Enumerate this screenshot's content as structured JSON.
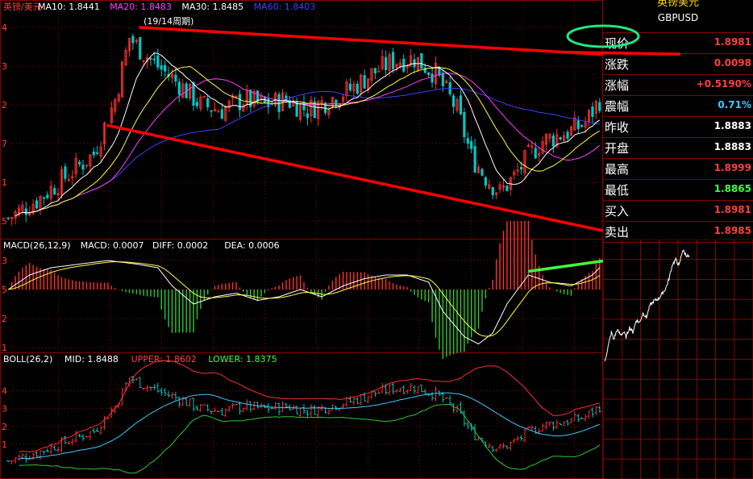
{
  "side": {
    "name": "英镑美元",
    "code": "GBPUSD",
    "rows": [
      {
        "label": "现价",
        "value": "1.8981",
        "color": "#ff4040"
      },
      {
        "label": "涨跌",
        "value": "0.0098",
        "color": "#ff4040"
      },
      {
        "label": "涨幅",
        "value": "+0.5190%",
        "color": "#ff4040"
      },
      {
        "label": "震幅",
        "value": "0.71%",
        "color": "#40c8ff"
      },
      {
        "label": "昨收",
        "value": "1.8883",
        "color": "#ffffff"
      },
      {
        "label": "开盘",
        "value": "1.8883",
        "color": "#ffffff"
      },
      {
        "label": "最高",
        "value": "1.8999",
        "color": "#ff4040"
      },
      {
        "label": "最低",
        "value": "1.8865",
        "color": "#40ff40"
      },
      {
        "label": "买入",
        "value": "1.8981",
        "color": "#ff4040"
      },
      {
        "label": "卖出",
        "value": "1.8985",
        "color": "#ff4040"
      }
    ]
  },
  "colors": {
    "bg": "#000000",
    "grid": "#8b0000",
    "up": "#ff3030",
    "down": "#00c8c8",
    "ma10": "#ffffff",
    "ma20": "#ffff40",
    "ma30": "#ff40ff",
    "ma60": "#4040ff",
    "trend": "#ff0000",
    "macd_up": "#ff3030",
    "macd_down": "#30c830",
    "diff": "#ffffff",
    "dea": "#ffff40",
    "boll_mid": "#40c8ff",
    "boll_upper": "#ff3030",
    "boll_lower": "#30c830",
    "circle": "#20e880",
    "green_trend": "#40ff40"
  },
  "chart_data": [
    {
      "type": "candlestick",
      "legend": [
        {
          "text": "英镑/美元",
          "color": "#ff4040"
        },
        {
          "text": "MA10: 1.8441",
          "color": "#ffffff"
        },
        {
          "text": "MA20: 1.8483",
          "color": "#ff40ff"
        },
        {
          "text": "MA30: 1.8485",
          "color": "#ffffff"
        },
        {
          "text": "MA60: 1.8403",
          "color": "#4040ff"
        }
      ],
      "annotation": "(19/14周期)",
      "ylim": [
        1.82,
        1.905
      ],
      "y_ticks": [
        {
          "v": 1.9,
          "t": "4"
        },
        {
          "v": 1.885,
          "t": "3"
        },
        {
          "v": 1.87,
          "t": "2"
        },
        {
          "v": 1.855,
          "t": "7"
        },
        {
          "v": 1.84,
          "t": "1"
        },
        {
          "v": 1.825,
          "t": "5"
        }
      ],
      "close_path": [
        [
          0,
          1.826
        ],
        [
          8,
          1.833
        ],
        [
          16,
          1.842
        ],
        [
          24,
          1.851
        ],
        [
          30,
          1.872
        ],
        [
          34,
          1.896
        ],
        [
          38,
          1.89
        ],
        [
          42,
          1.885
        ],
        [
          48,
          1.878
        ],
        [
          54,
          1.87
        ],
        [
          60,
          1.868
        ],
        [
          66,
          1.872
        ],
        [
          72,
          1.87
        ],
        [
          78,
          1.872
        ],
        [
          84,
          1.868
        ],
        [
          90,
          1.872
        ],
        [
          96,
          1.876
        ],
        [
          102,
          1.882
        ],
        [
          108,
          1.887
        ],
        [
          114,
          1.888
        ],
        [
          120,
          1.882
        ],
        [
          126,
          1.868
        ],
        [
          130,
          1.85
        ],
        [
          134,
          1.842
        ],
        [
          138,
          1.836
        ],
        [
          142,
          1.842
        ],
        [
          146,
          1.85
        ],
        [
          150,
          1.856
        ],
        [
          154,
          1.858
        ],
        [
          158,
          1.86
        ],
        [
          162,
          1.863
        ],
        [
          166,
          1.872
        ]
      ],
      "trend_lines": [
        {
          "from": [
            37,
            1.9
          ],
          "to": [
            186,
            1.888
          ]
        },
        {
          "from": [
            28,
            1.862
          ],
          "to": [
            178,
            1.818
          ]
        }
      ],
      "n": 167
    },
    {
      "type": "macd",
      "legend": [
        {
          "text": "MACD(26,12,9)",
          "color": "#ffffff"
        },
        {
          "text": "MACD: 0.0007",
          "color": "#ffffff"
        },
        {
          "text": "DIFF: 0.0002",
          "color": "#ffffff"
        },
        {
          "text": "DEA: 0.0006",
          "color": "#ffffff"
        }
      ],
      "ylim": [
        -0.016,
        0.01
      ],
      "y_ticks": [
        {
          "v": 0.008,
          "t": "3"
        },
        {
          "v": 0.0,
          "t": "5"
        },
        {
          "v": -0.008,
          "t": "2"
        },
        {
          "v": -0.016,
          "t": "1"
        }
      ],
      "diff_path": [
        [
          0,
          0.0
        ],
        [
          6,
          0.004
        ],
        [
          12,
          0.006
        ],
        [
          20,
          0.007
        ],
        [
          28,
          0.008
        ],
        [
          36,
          0.007
        ],
        [
          42,
          0.006
        ],
        [
          46,
          0.001
        ],
        [
          52,
          -0.004
        ],
        [
          58,
          -0.002
        ],
        [
          64,
          -0.001
        ],
        [
          70,
          -0.003
        ],
        [
          76,
          -0.002
        ],
        [
          82,
          0.0
        ],
        [
          88,
          -0.002
        ],
        [
          94,
          0.001
        ],
        [
          100,
          0.003
        ],
        [
          106,
          0.004
        ],
        [
          112,
          0.004
        ],
        [
          118,
          0.002
        ],
        [
          122,
          -0.006
        ],
        [
          128,
          -0.013
        ],
        [
          132,
          -0.015
        ],
        [
          136,
          -0.012
        ],
        [
          140,
          -0.004
        ],
        [
          146,
          0.004
        ],
        [
          152,
          0.002
        ],
        [
          158,
          0.001
        ],
        [
          164,
          0.004
        ],
        [
          166,
          0.006
        ]
      ],
      "green_line": {
        "from": [
          146,
          0.005
        ],
        "to": [
          168,
          0.008
        ]
      }
    },
    {
      "type": "boll",
      "legend": [
        {
          "text": "BOLL(26,2)",
          "color": "#ffffff"
        },
        {
          "text": "MID: 1.8488",
          "color": "#ffffff"
        },
        {
          "text": "UPPER: 1.8602",
          "color": "#ff4040"
        },
        {
          "text": "LOWER: 1.8375",
          "color": "#40ff40"
        }
      ],
      "ylim": [
        1.815,
        1.905
      ],
      "y_ticks": [
        {
          "v": 1.885,
          "t": "4"
        },
        {
          "v": 1.87,
          "t": "3"
        },
        {
          "v": 1.855,
          "t": "2"
        },
        {
          "v": 1.84,
          "t": "1"
        }
      ]
    },
    {
      "type": "line",
      "note": "intraday tick chart",
      "y_path": [
        [
          0,
          0.05
        ],
        [
          3,
          0.18
        ],
        [
          6,
          0.3
        ],
        [
          8,
          0.24
        ],
        [
          11,
          0.32
        ],
        [
          14,
          0.28
        ],
        [
          17,
          0.3
        ],
        [
          19,
          0.26
        ],
        [
          22,
          0.34
        ],
        [
          25,
          0.3
        ],
        [
          28,
          0.4
        ],
        [
          31,
          0.38
        ],
        [
          34,
          0.46
        ],
        [
          37,
          0.42
        ],
        [
          40,
          0.52
        ],
        [
          44,
          0.56
        ],
        [
          48,
          0.58
        ],
        [
          51,
          0.62
        ],
        [
          54,
          0.66
        ],
        [
          57,
          0.74
        ],
        [
          60,
          0.86
        ],
        [
          63,
          0.9
        ],
        [
          66,
          0.85
        ],
        [
          69,
          0.98
        ],
        [
          72,
          0.94
        ],
        [
          75,
          0.92
        ]
      ]
    }
  ]
}
